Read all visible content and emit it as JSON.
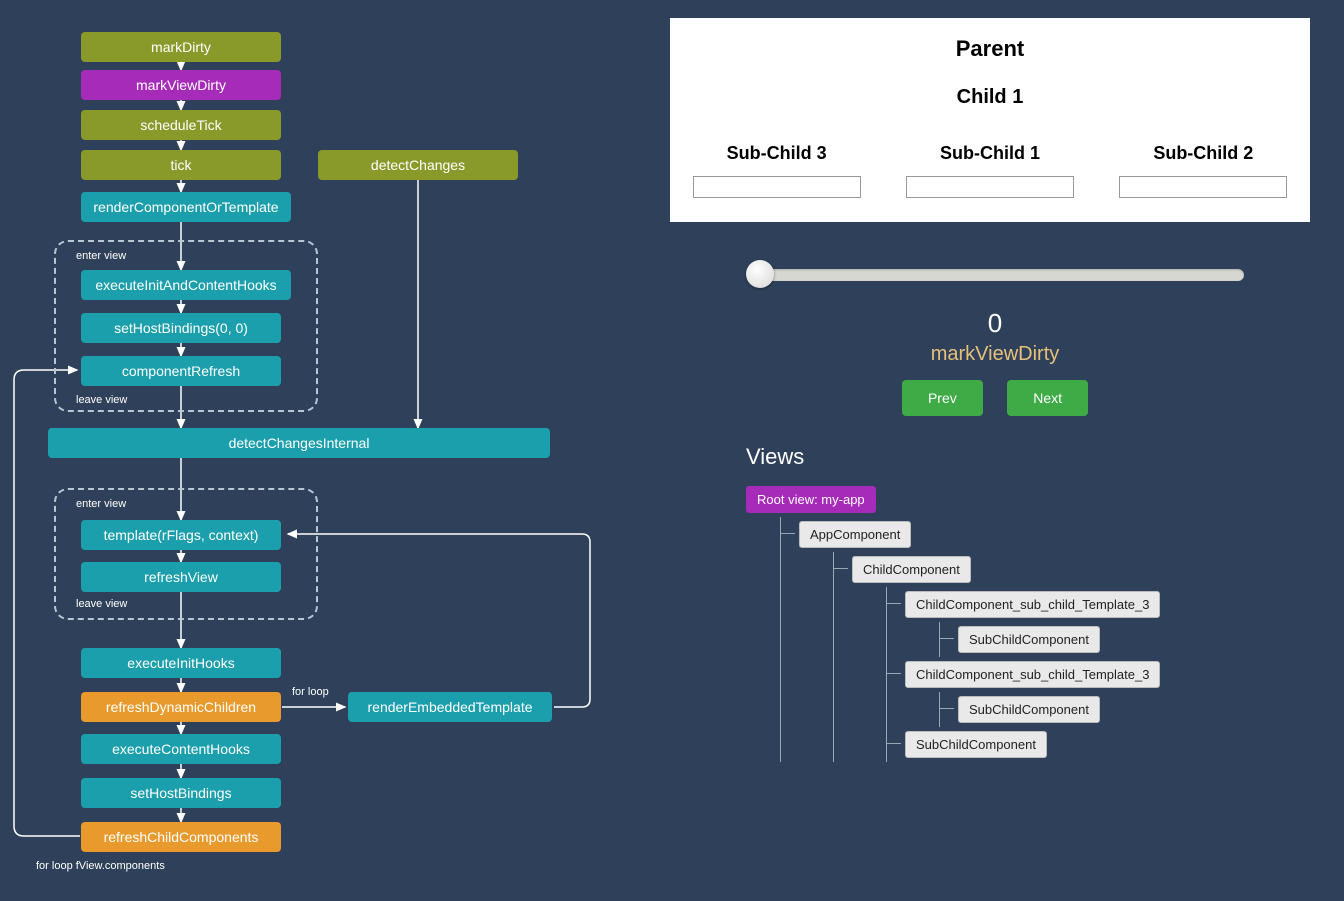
{
  "flow": {
    "markDirty": "markDirty",
    "markViewDirty": "markViewDirty",
    "scheduleTick": "scheduleTick",
    "tick": "tick",
    "detectChanges": "detectChanges",
    "renderComponentOrTemplate": "renderComponentOrTemplate",
    "group1_enter": "enter view",
    "group1_leave": "leave view",
    "executeInitAndContentHooks": "executeInitAndContentHooks",
    "setHostBindings00": "setHostBindings(0, 0)",
    "componentRefresh": "componentRefresh",
    "detectChangesInternal": "detectChangesInternal",
    "group2_enter": "enter view",
    "group2_leave": "leave view",
    "template": "template(rFlags, context)",
    "refreshView": "refreshView",
    "executeInitHooks": "executeInitHooks",
    "refreshDynamicChildren": "refreshDynamicChildren",
    "forLoop": "for loop",
    "renderEmbeddedTemplate": "renderEmbeddedTemplate",
    "executeContentHooks": "executeContentHooks",
    "setHostBindings": "setHostBindings",
    "refreshChildComponents": "refreshChildComponents",
    "forLoopComponents": "for loop fView.components"
  },
  "card": {
    "parent": "Parent",
    "child1": "Child 1",
    "sub3": "Sub-Child 3",
    "sub1": "Sub-Child 1",
    "sub2": "Sub-Child 2"
  },
  "slider": {
    "value": 0
  },
  "step": {
    "num": "0",
    "name": "markViewDirty"
  },
  "buttons": {
    "prev": "Prev",
    "next": "Next"
  },
  "views": {
    "title": "Views",
    "root": "Root view: my-app",
    "app": "AppComponent",
    "child": "ChildComponent",
    "tpl3a": "ChildComponent_sub_child_Template_3",
    "subA": "SubChildComponent",
    "tpl3b": "ChildComponent_sub_child_Template_3",
    "subB": "SubChildComponent",
    "subC": "SubChildComponent"
  }
}
